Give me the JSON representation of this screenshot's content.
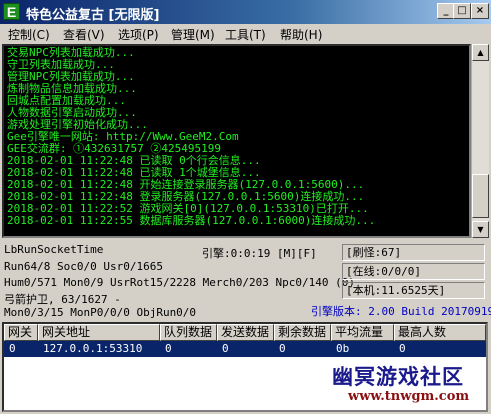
{
  "window": {
    "title": "特色公益复古 [无限版]",
    "icon_letter": "E",
    "buttons": {
      "minimize": "_",
      "maximize": "□",
      "close": "×"
    }
  },
  "menu": [
    "控制(C)",
    "查看(V)",
    "选项(P)",
    "管理(M)",
    "工具(T)",
    "帮助(H)"
  ],
  "log_lines": [
    "交易NPC列表加载成功...",
    "守卫列表加载成功...",
    "管理NPC列表加载成功...",
    "炼制物品信息加载成功...",
    "回城点配置加载成功...",
    "人物数据引擎启动成功...",
    "游戏处理引擎初始化成功...",
    "Gee引擎唯一网站: http://Www.GeeM2.Com",
    "GEE交流群: ①432631757   ②425495199",
    "2018-02-01 11:22:48 已读取 0个行会信息...",
    "2018-02-01 11:22:48 已读取 1个城堡信息...",
    "2018-02-01 11:22:48 开始连接登录服务器(127.0.0.1:5600)...",
    "2018-02-01 11:22:48 登录服务器(127.0.0.1:5600)连接成功...",
    "2018-02-01 11:22:52 游戏网关[0](127.0.0.1:53310)已打开...",
    "2018-02-01 11:22:55 数据库服务器(127.0.0.1:6000)连接成功..."
  ],
  "status": {
    "line1": "LbRunSocketTime",
    "line2": "Run64/8 Soc0/0 Usr0/1665",
    "line3": "Hum0/571 Mon0/9 UsrRot15/2228 Merch0/203 Npc0/140 (0)",
    "line4": "弓箭护卫, 63/1627 -",
    "line5": "Mon0/3/15 MonP0/0/0 ObjRun0/0",
    "engine": "引擎:0:0:19 [M][F]",
    "refresh": "[刷怪:67]",
    "online": "[在线:0/0/0]",
    "local": "[本机:11.6525天]",
    "version": "引擎版本: 2.00 Build 20170919"
  },
  "table": {
    "headers": [
      "网关",
      "网关地址",
      "队列数据",
      "发送数据",
      "剩余数据",
      "平均流量",
      "最高人数"
    ],
    "rows": [
      [
        "0",
        "127.0.0.1:53310",
        "0",
        "0",
        "0",
        "0b",
        "0"
      ]
    ]
  },
  "watermark": {
    "logo": "幽冥游戏社区",
    "url": "www.tnwgm.com"
  },
  "colors": {
    "log_text": "#22ee22",
    "selection": "#0a246a",
    "version_text": "#0000c0"
  }
}
